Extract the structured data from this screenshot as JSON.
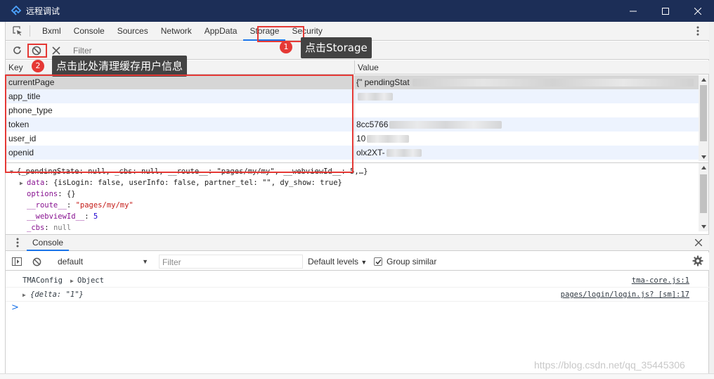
{
  "window": {
    "title": "远程调试",
    "minimize_glyph": "—",
    "maximize_glyph": "☐",
    "close_glyph": "✕"
  },
  "tabs": [
    "Bxml",
    "Console",
    "Sources",
    "Network",
    "AppData",
    "Storage",
    "Security"
  ],
  "active_tab": "Storage",
  "storage": {
    "filter_placeholder": "Filter",
    "columns": {
      "key": "Key",
      "value": "Value"
    },
    "rows": [
      {
        "key": "currentPage",
        "value": "{\" pendingStat"
      },
      {
        "key": "app_title",
        "value": ""
      },
      {
        "key": "phone_type",
        "value": ""
      },
      {
        "key": "token",
        "value": "8cc5766"
      },
      {
        "key": "user_id",
        "value": "10"
      },
      {
        "key": "openid",
        "value": "olx2XT-"
      }
    ]
  },
  "preview": {
    "line1": "{_pendingState: null, _cbs: null, __route__: \"pages/my/my\", __webviewId__: 5,…}",
    "data_key": "data",
    "data_val": "{isLogin: false, userInfo: false, partner_tel: \"\", dy_show: true}",
    "options_key": "options",
    "options_val": "{}",
    "route_key": "__route__",
    "route_val": "\"pages/my/my\"",
    "webview_key": "__webviewId__",
    "webview_val": "5",
    "cbs_key": "_cbs",
    "cbs_val": "null"
  },
  "drawer": {
    "tab": "Console"
  },
  "console": {
    "context": "default",
    "filter_placeholder": "Filter",
    "levels": "Default levels",
    "group_similar": "Group similar",
    "messages": [
      {
        "label": "TMAConfig",
        "obj": "Object",
        "source": "tma-core.js:1"
      },
      {
        "label": "",
        "obj": "{delta: \"1\"}",
        "source": "pages/login/login.js? [sm]:17"
      }
    ],
    "prompt": ">"
  },
  "annotations": {
    "badge1": "1",
    "callout1": "点击Storage",
    "badge2": "2",
    "callout2": "点击此处清理缓存用户信息",
    "accent": "#e53935"
  },
  "watermark": "https://blog.csdn.net/qq_35445306"
}
